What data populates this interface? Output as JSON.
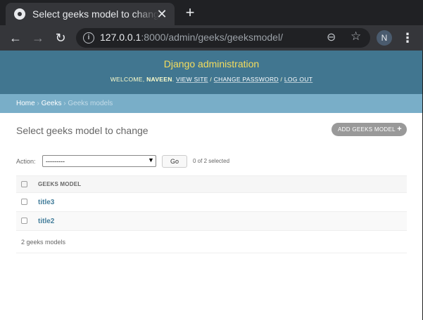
{
  "browser": {
    "tab_title": "Select geeks model to change | Django site admin",
    "close_glyph": "✕",
    "new_tab_glyph": "+",
    "back_glyph": "←",
    "forward_glyph": "→",
    "reload_glyph": "↻",
    "url_host": "127.0.0.1",
    "url_rest": ":8000/admin/geeks/geeksmodel/",
    "zoom_glyph": "⊖",
    "star_glyph": "☆",
    "profile_initial": "N",
    "menu_glyph": "⋮"
  },
  "header": {
    "brand": "Django administration",
    "welcome": "Welcome,",
    "username": "Naveen",
    "view_site": "View site",
    "change_password": "Change password",
    "log_out": "Log out",
    "sep": " / "
  },
  "breadcrumbs": {
    "home": "Home",
    "app": "Geeks",
    "current": "Geeks models",
    "sep": " › "
  },
  "content": {
    "title": "Select geeks model to change",
    "add_button": "ADD GEEKS MODEL",
    "add_glyph": "+",
    "action_label": "Action:",
    "action_selected": "---------",
    "go_button": "Go",
    "selection_counter": "0 of 2 selected"
  },
  "table": {
    "column_header": "GEEKS MODEL",
    "rows": [
      {
        "title": "title3"
      },
      {
        "title": "title2"
      }
    ],
    "paginator": "2 geeks models"
  },
  "colors": {
    "header_bg": "#417690",
    "brand_text": "#f5dd5d",
    "breadcrumb_bg": "#79aec8",
    "link": "#447e9b"
  }
}
